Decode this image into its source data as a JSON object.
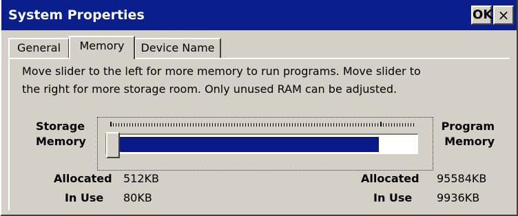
{
  "window": {
    "title": "System Properties",
    "ok_label": "OK",
    "close_label": "×"
  },
  "tabs": [
    {
      "label": "General",
      "active": false
    },
    {
      "label": "Memory",
      "active": true
    },
    {
      "label": "Device Name",
      "active": false
    }
  ],
  "description": {
    "line1": "Move slider to the left for more memory to run programs. Move slider to",
    "line2": "the right for more storage room. Only unused RAM can be adjusted."
  },
  "storage": {
    "label_line1": "Storage",
    "label_line2": "Memory",
    "allocated_label": "Allocated",
    "allocated": "512KB",
    "inuse_label": "In Use",
    "inuse": "80KB"
  },
  "program": {
    "label_line1": "Program",
    "label_line2": "Memory",
    "allocated_label": "Allocated",
    "allocated": "95584KB",
    "inuse_label": "In Use",
    "inuse": "9936KB"
  },
  "slider": {
    "program_fraction": 0.88,
    "thumb_fraction": 0.0
  },
  "colors": {
    "titlebar": "#0a1e8c",
    "fill": "#0a1a88"
  }
}
